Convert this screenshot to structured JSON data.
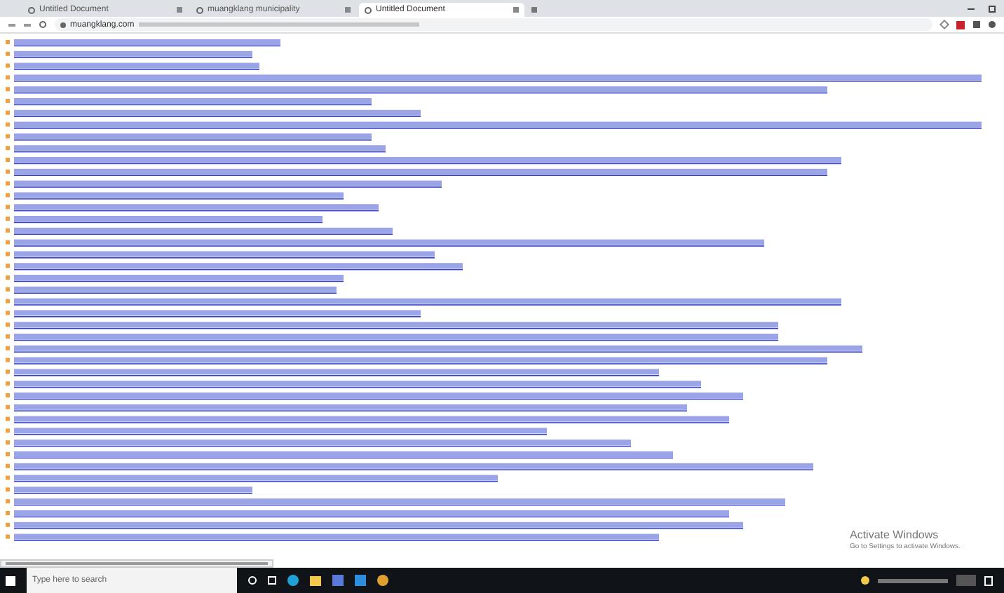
{
  "browser": {
    "tabs": [
      {
        "title": "Untitled Document",
        "selected": false
      },
      {
        "title": "muangklang municipality",
        "selected": false
      },
      {
        "title": "Untitled Document",
        "selected": true
      }
    ],
    "address": "muangklang.com"
  },
  "watermark": {
    "title": "Activate Windows",
    "subtitle": "Go to Settings to activate Windows."
  },
  "taskbar": {
    "search_placeholder": "Type here to search"
  }
}
